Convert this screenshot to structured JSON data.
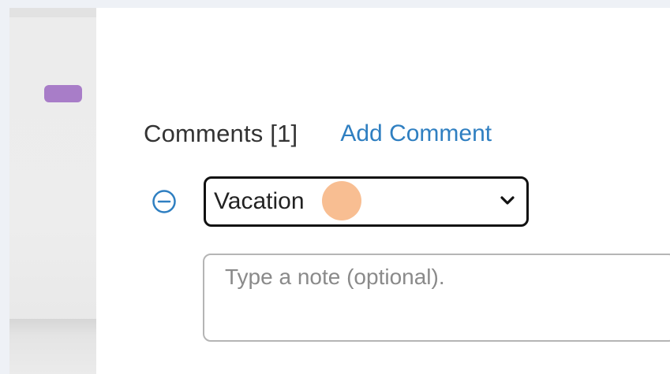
{
  "comments": {
    "title": "Comments [1]",
    "add_label": "Add Comment",
    "items": [
      {
        "type_selected": "Vacation",
        "note_value": "",
        "note_placeholder": "Type a note (optional)."
      }
    ]
  },
  "icons": {
    "remove": "minus-circle-icon",
    "dropdown": "chevron-down-icon"
  },
  "colors": {
    "link": "#2f7fc1",
    "badge": "#a87dc8",
    "click_marker": "#f6a86e"
  }
}
